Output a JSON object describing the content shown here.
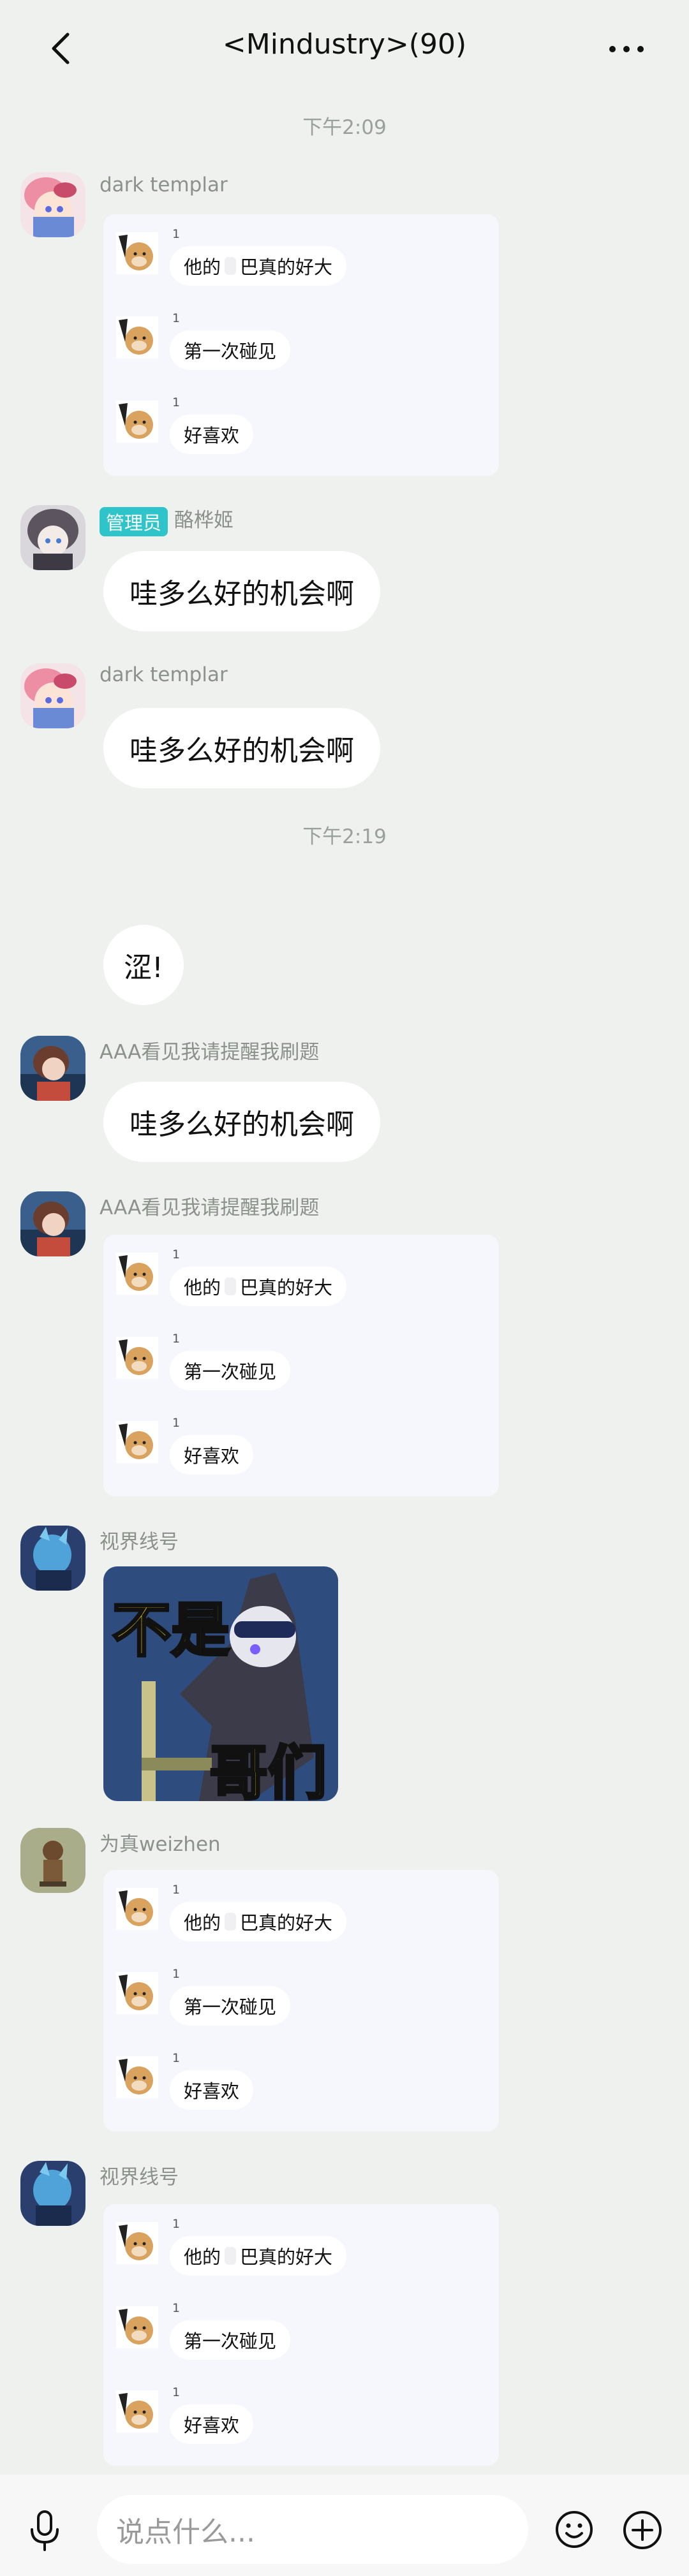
{
  "header": {
    "title": "<Mindustry>(90)"
  },
  "timestamps": {
    "t1": "下午2:09",
    "t2": "下午2:19"
  },
  "forward": {
    "num": "1",
    "line1_a": "他的",
    "line1_b": "巴真的好大",
    "line2": "第一次碰见",
    "line3": "好喜欢"
  },
  "messages": {
    "m1": {
      "sender": "dark templar"
    },
    "m2": {
      "badge": "管理员",
      "sender": "酪桦姬",
      "text": "哇多么好的机会啊"
    },
    "m3": {
      "sender": "dark templar",
      "text": "哇多么好的机会啊"
    },
    "m4": {
      "text": "涩!"
    },
    "m5": {
      "sender": "AAA看见我请提醒我刷题",
      "text": "哇多么好的机会啊"
    },
    "m6": {
      "sender": "AAA看见我请提醒我刷题"
    },
    "m7": {
      "sender": "视界线号",
      "sticker_top": "不是",
      "sticker_bottom": "哥们"
    },
    "m8": {
      "sender": "为真weizhen"
    },
    "m9": {
      "sender": "视界线号"
    }
  },
  "input": {
    "placeholder": "说点什么..."
  },
  "icons": {
    "back": "chevron-left-icon",
    "more": "more-dots-icon",
    "mic": "microphone-icon",
    "emoji": "emoji-icon",
    "plus": "plus-circle-icon"
  }
}
